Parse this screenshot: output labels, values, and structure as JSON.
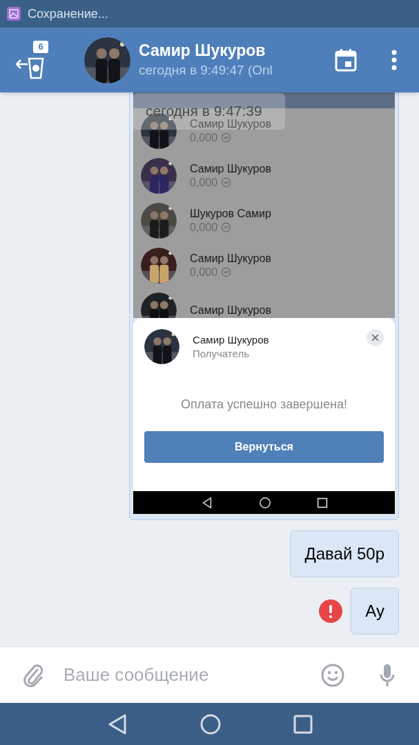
{
  "status_bar": {
    "notification": "Сохранение..."
  },
  "header": {
    "unread_badge": "6",
    "name": "Самир Шукуров",
    "last_seen": "сегодня в 9:49:47 (Onl"
  },
  "messages": [
    {
      "kind": "screenshot",
      "date_overlay": "сегодня в 9:47:39",
      "contacts": [
        {
          "name": "Самир Шукуров",
          "balance": "0,000"
        },
        {
          "name": "Самир Шукуров",
          "balance": "0,000"
        },
        {
          "name": "Шукуров Самир",
          "balance": "0,000"
        },
        {
          "name": "Самир Шукуров",
          "balance": "0,000"
        },
        {
          "name": "Самир Шукуров"
        }
      ],
      "sheet": {
        "name": "Самир Шукуров",
        "role": "Получатель",
        "message": "Оплата успешно завершена!",
        "button": "Вернуться"
      }
    },
    {
      "kind": "text",
      "text": "Давай 50р",
      "failed": false
    },
    {
      "kind": "text",
      "text": "Ау",
      "failed": true
    }
  ],
  "composer": {
    "placeholder": "Ваше сообщение"
  }
}
